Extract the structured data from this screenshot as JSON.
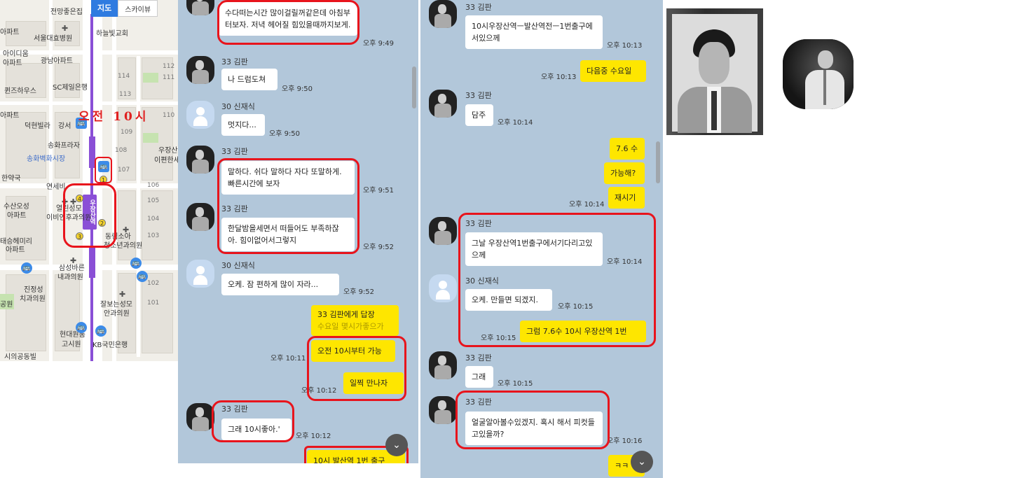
{
  "map": {
    "tabs": {
      "map": "지도",
      "skyview": "스카이뷰"
    },
    "annotation": "오전 10시",
    "station_label": "우장산역",
    "labels": [
      "전망좋은집",
      "아파트",
      "서울대효병원",
      "하늘빛교회",
      "아이디움",
      "아파트",
      "광남아파트",
      "퀸즈하우스",
      "SC제일은행",
      "아파트",
      "덕현빌라",
      "강서",
      "송화프라자",
      "우장산",
      "이편한세",
      "송화벽화시장",
      "한약국",
      "연세비",
      "수산오성",
      "아파트",
      "열린성모",
      "이비인후과의원",
      "태승헤미리",
      "아파트",
      "동림소아",
      "청소년과의원",
      "삼성바른",
      "내과의원",
      "진정성",
      "치과의원",
      "공원",
      "잘보는성모",
      "안과의원",
      "현대원룸",
      "고시원",
      "KB국민은행",
      "시의공동빌"
    ],
    "building_numbers": [
      "114",
      "113",
      "112",
      "111",
      "110",
      "109",
      "108",
      "107",
      "106",
      "105",
      "104",
      "103",
      "102",
      "101"
    ],
    "exits": [
      "1",
      "2",
      "3",
      "4"
    ]
  },
  "chat1": {
    "messages": [
      {
        "text": "수다떠는시간 많이걸릴꺼같은데 아침부터보자. 저녁 헤어질 힘있을때까지보게.",
        "time": "오후 9:49"
      },
      {
        "name": "33 김판",
        "text": "나 드럼도쳐",
        "time": "오후 9:50"
      },
      {
        "name": "30 신재식",
        "text": "멋지다...",
        "time": "오후 9:50"
      },
      {
        "name": "33 김판",
        "text": "말하다.  쉬다 말하다 자다 또말하게.  빠른시간에 보자",
        "time": "오후 9:51"
      },
      {
        "name": "33 김판",
        "text": "한달밤을세면서 떠들어도 부족하잖아. 힘이없어서그렇지",
        "time": "오후 9:52"
      },
      {
        "name": "30 신재식",
        "text": "오케.  잠 편하게 많이 자라...",
        "time": "오후 9:52"
      },
      {
        "reply_header": "33 김판에게 답장",
        "reply_quote": "수요일 몇시가좋으가",
        "text": "오전 10시부터 가능",
        "time": "오후 10:11"
      },
      {
        "text": "일찍 만나자",
        "time": "오후 10:12"
      },
      {
        "name": "33 김판",
        "text": "그래 10시좋아.'",
        "time": "오후 10:12"
      },
      {
        "text": "10시 발산역 1번 출구"
      }
    ]
  },
  "chat2": {
    "messages": [
      {
        "name": "33 김판",
        "text": "10시우장산역ㅡ발산역전ㅡ1번출구에서있으께",
        "time": "오후 10:13"
      },
      {
        "text": "다음중 수요일",
        "time": "오후 10:13"
      },
      {
        "name": "33 김판",
        "text": "담주",
        "time": "오후 10:14"
      },
      {
        "text": "7.6 수"
      },
      {
        "text": "가능해?"
      },
      {
        "text": "재시기",
        "time": "오후 10:14"
      },
      {
        "name": "33 김판",
        "text": "그날 우장산역1번출구에서기다리고있으께",
        "time": "오후 10:14"
      },
      {
        "name": "30 신재식",
        "text": "오케. 만들면 되겠지.",
        "time": "오후 10:15"
      },
      {
        "text": "그럼 7.6수 10시 우장산역 1번",
        "time": "오후 10:15"
      },
      {
        "name": "33 김판",
        "text": "그래",
        "time": "오후 10:15"
      },
      {
        "name": "33 김판",
        "text": "얼굴알아볼수있겠지. 혹시 해서 피컷들고있을까?",
        "time": "오후 10:16"
      },
      {
        "text": "ㅋㅋ"
      }
    ]
  },
  "colors": {
    "chat_bg": "#b2c7da",
    "my_bubble": "#fee600",
    "annotation_red": "#e8141c",
    "metro_purple": "#8a4fd6"
  }
}
